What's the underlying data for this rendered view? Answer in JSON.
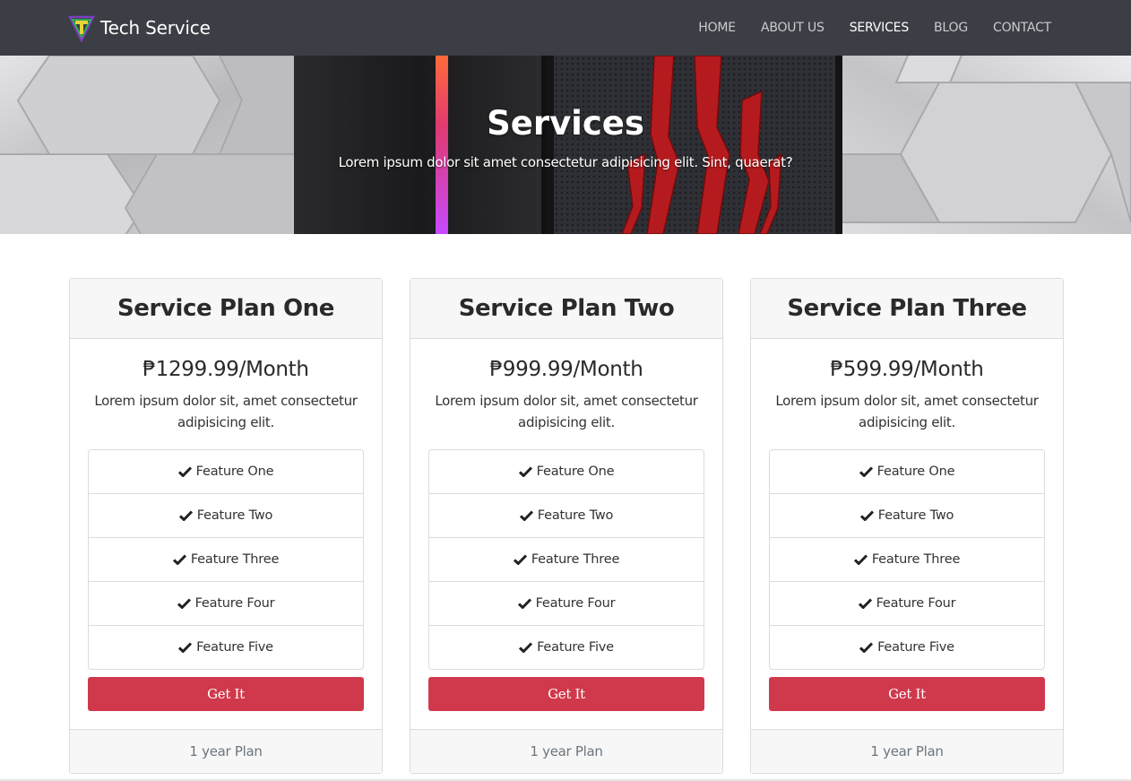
{
  "brand": {
    "name": "Tech Service",
    "logo_letter": "T"
  },
  "nav": {
    "items": [
      {
        "label": "HOME",
        "active": false
      },
      {
        "label": "ABOUT US",
        "active": false
      },
      {
        "label": "SERVICES",
        "active": true
      },
      {
        "label": "BLOG",
        "active": false
      },
      {
        "label": "CONTACT",
        "active": false
      }
    ]
  },
  "hero": {
    "title": "Services",
    "subtitle": "Lorem ipsum dolor sit amet consectetur adipisicing elit. Sint, quaerat?"
  },
  "plans": [
    {
      "title": "Service Plan One",
      "price": "₱1299.99/Month",
      "description": "Lorem ipsum dolor sit, amet consectetur adipisicing elit.",
      "features": [
        "Feature One",
        "Feature Two",
        "Feature Three",
        "Feature Four",
        "Feature Five"
      ],
      "button": "Get It",
      "footer": "1 year Plan"
    },
    {
      "title": "Service Plan Two",
      "price": "₱999.99/Month",
      "description": "Lorem ipsum dolor sit, amet consectetur adipisicing elit.",
      "features": [
        "Feature One",
        "Feature Two",
        "Feature Three",
        "Feature Four",
        "Feature Five"
      ],
      "button": "Get It",
      "footer": "1 year Plan"
    },
    {
      "title": "Service Plan Three",
      "price": "₱599.99/Month",
      "description": "Lorem ipsum dolor sit, amet consectetur adipisicing elit.",
      "features": [
        "Feature One",
        "Feature Two",
        "Feature Three",
        "Feature Four",
        "Feature Five"
      ],
      "button": "Get It",
      "footer": "1 year Plan"
    }
  ],
  "icons": {
    "feature": "check-icon",
    "logo": "tech-logo-icon"
  },
  "colors": {
    "navbar": "#3b3e44",
    "button": "#d0384b",
    "card_header": "#f7f7f7"
  }
}
